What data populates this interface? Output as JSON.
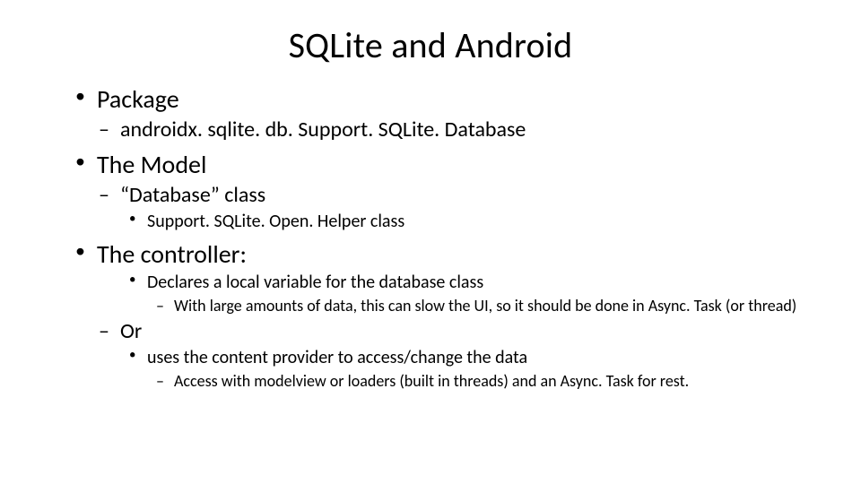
{
  "title": "SQLite and Android",
  "bullets": {
    "package": "Package",
    "package_sub": "androidx. sqlite. db. Support. SQLite. Database",
    "model": "The Model",
    "model_sub": "“Database” class",
    "model_sub_sub": "Support. SQLite. Open. Helper class",
    "controller": "The controller:",
    "controller_l3a": "Declares a local variable for the database class",
    "controller_l4a": "With large amounts of data, this can slow the UI, so it should be done in Async. Task (or thread)",
    "controller_or": "Or",
    "controller_l3b": "uses the content provider to access/change the data",
    "controller_l4b": "Access with modelview or loaders (built in threads)  and  an Async. Task for rest."
  }
}
